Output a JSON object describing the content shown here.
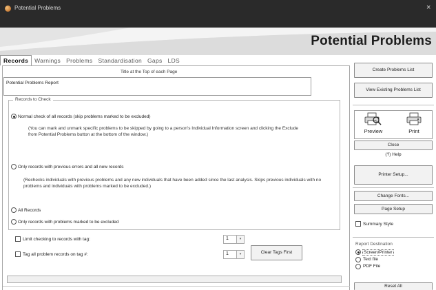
{
  "window": {
    "title": "Potential Problems",
    "close_glyph": "×"
  },
  "header": {
    "title": "Potential Problems"
  },
  "tabs": [
    {
      "label": "Records",
      "active": true
    },
    {
      "label": "Warnings",
      "active": false
    },
    {
      "label": "Problems",
      "active": false
    },
    {
      "label": "Standardisation",
      "active": false
    },
    {
      "label": "Gaps",
      "active": false
    },
    {
      "label": "LDS",
      "active": false
    }
  ],
  "main": {
    "caption": "Title at the Top of each Page",
    "report_title": "Potential Problems Report",
    "records_group_label": "Records to Check",
    "options": {
      "normal": {
        "label": "Normal check of all records (skip problems marked to be excluded)",
        "selected": true
      },
      "normal_note": "(You can mark and unmark specific problems to be skipped by going to a person's Individual Information screen and clicking the Exclude from Potential Problems button at the bottom of the window.)",
      "errors_new": {
        "label": "Only records with previous errors and all new records",
        "selected": false
      },
      "errors_new_note": "(Rechecks individuals with previous problems and any new individuals that have been added since the last analysis. Skips previous individuals with no problems and individuals with problems marked to be excluded.)",
      "all": {
        "label": "All Records",
        "selected": false
      },
      "excluded": {
        "label": "Only records with problems marked to be excluded",
        "selected": false
      }
    },
    "limit_tag": {
      "label": "Limit checking to records with tag:",
      "value": "1",
      "checked": false
    },
    "tag_all": {
      "label": "Tag all problem records on tag #:",
      "value": "1",
      "checked": false
    },
    "clear_tags_button": "Clear Tags First"
  },
  "right": {
    "create_list": "Create Problems List",
    "view_existing": "View Existing Problems List",
    "preview": "Preview",
    "print": "Print",
    "close": "Close",
    "help": "Help",
    "printer_setup": "Printer Setup...",
    "change_fonts": "Change Fonts...",
    "page_setup": "Page Setup",
    "summary_style": "Summary Style",
    "report_destination": "Report Destination",
    "destinations": [
      {
        "label": "Screen/Printer",
        "selected": true
      },
      {
        "label": "Text file",
        "selected": false
      },
      {
        "label": "PDF File",
        "selected": false
      }
    ],
    "reset_all": "Reset All"
  },
  "icons": {
    "app": "family-tree-app-icon",
    "preview": "printer-preview-icon",
    "print": "printer-icon",
    "help": "help-icon",
    "close": "close-icon"
  },
  "colors": {
    "titlebar": "#2a2a2a",
    "header_band": "#e4e4e4",
    "accent_swoosh": "#f7f7f7"
  }
}
